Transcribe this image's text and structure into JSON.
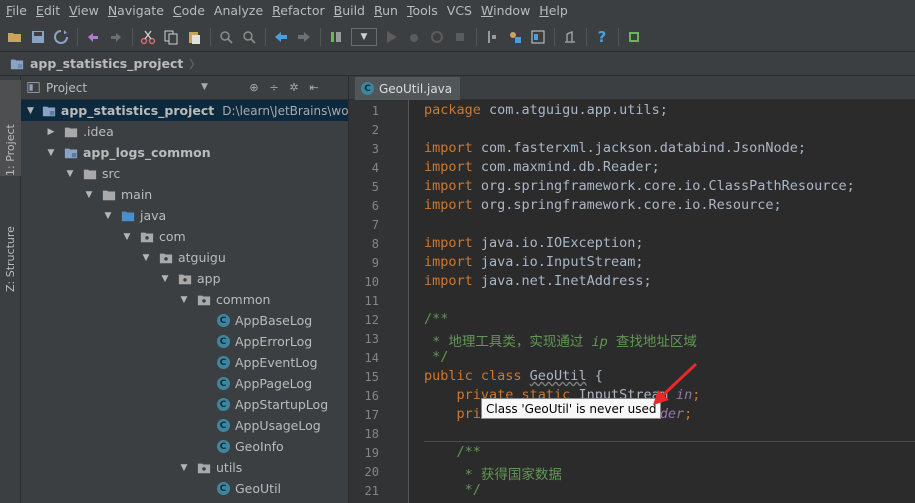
{
  "menu": [
    {
      "first": "F",
      "rest": "ile"
    },
    {
      "first": "E",
      "rest": "dit"
    },
    {
      "first": "V",
      "rest": "iew"
    },
    {
      "first": "N",
      "rest": "avigate"
    },
    {
      "first": "C",
      "rest": "ode"
    },
    {
      "first": "",
      "rest": "Analyze"
    },
    {
      "first": "R",
      "rest": "efactor"
    },
    {
      "first": "B",
      "rest": "uild"
    },
    {
      "first": "R",
      "rest": "un"
    },
    {
      "first": "T",
      "rest": "ools"
    },
    {
      "first": "",
      "rest": "VCS"
    },
    {
      "first": "W",
      "rest": "indow"
    },
    {
      "first": "H",
      "rest": "elp"
    }
  ],
  "breadcrumb": {
    "project": "app_statistics_project"
  },
  "toolstrip": {
    "project_tab": "1: Project",
    "structure_tab": "Z: Structure"
  },
  "project_panel": {
    "title": "Project",
    "tree": [
      {
        "label": "app_statistics_project",
        "path": "D:\\learn\\JetBrains\\worksp",
        "depth": 0,
        "expanded": true,
        "bold": true,
        "icon": "module-folder-icon",
        "selected": true
      },
      {
        "label": ".idea",
        "depth": 1,
        "expanded": false,
        "icon": "folder-icon"
      },
      {
        "label": "app_logs_common",
        "depth": 1,
        "expanded": true,
        "bold": true,
        "icon": "module-folder-icon"
      },
      {
        "label": "src",
        "depth": 2,
        "expanded": true,
        "icon": "folder-icon"
      },
      {
        "label": "main",
        "depth": 3,
        "expanded": true,
        "icon": "folder-icon"
      },
      {
        "label": "java",
        "depth": 4,
        "expanded": true,
        "icon": "source-folder-icon"
      },
      {
        "label": "com",
        "depth": 5,
        "expanded": true,
        "icon": "package-icon"
      },
      {
        "label": "atguigu",
        "depth": 6,
        "expanded": true,
        "icon": "package-icon"
      },
      {
        "label": "app",
        "depth": 7,
        "expanded": true,
        "icon": "package-icon"
      },
      {
        "label": "common",
        "depth": 8,
        "expanded": true,
        "icon": "package-icon"
      },
      {
        "label": "AppBaseLog",
        "depth": 9,
        "icon": "class-icon"
      },
      {
        "label": "AppErrorLog",
        "depth": 9,
        "icon": "class-icon"
      },
      {
        "label": "AppEventLog",
        "depth": 9,
        "icon": "class-icon"
      },
      {
        "label": "AppPageLog",
        "depth": 9,
        "icon": "class-icon"
      },
      {
        "label": "AppStartupLog",
        "depth": 9,
        "icon": "class-icon"
      },
      {
        "label": "AppUsageLog",
        "depth": 9,
        "icon": "class-icon"
      },
      {
        "label": "GeoInfo",
        "depth": 9,
        "icon": "class-icon"
      },
      {
        "label": "utils",
        "depth": 8,
        "expanded": true,
        "icon": "package-icon"
      },
      {
        "label": "GeoUtil",
        "depth": 9,
        "icon": "class-icon"
      }
    ]
  },
  "editor": {
    "tab_label": "GeoUtil.java",
    "line_numbers": [
      "1",
      "2",
      "3",
      "4",
      "5",
      "6",
      "7",
      "8",
      "9",
      "10",
      "11",
      "12",
      "13",
      "14",
      "15",
      "16",
      "17",
      "18",
      "19",
      "20",
      "21"
    ],
    "code": {
      "l1_kw": "package",
      "l1_rest": " com.atguigu.app.utils;",
      "l3_kw": "import",
      "l3_rest": " com.fasterxml.jackson.databind.JsonNode;",
      "l4_kw": "import",
      "l4_rest": " com.maxmind.db.Reader;",
      "l5_kw": "import",
      "l5_rest": " org.springframework.core.io.ClassPathResource;",
      "l6_kw": "import",
      "l6_rest": " org.springframework.core.io.Resource;",
      "l8_kw": "import",
      "l8_rest": " java.io.IOException;",
      "l9_kw": "import",
      "l9_rest": " java.io.InputStream;",
      "l10_kw": "import",
      "l10_rest": " java.net.InetAddress;",
      "l12": "/**",
      "l13_a": " * 地理工具类，实现通过 ",
      "l13_b": "ip",
      "l13_c": " 查找地址区域",
      "l14": " */",
      "l15_kw": "public class ",
      "l15_name": "GeoUtil",
      "l15_rest": " {",
      "l16_kw": "    private static ",
      "l16_type": "InputStream ",
      "l16_field": "in",
      "l17_kw": "    private static ",
      "l17_type": "Reader ",
      "l17_field": "reader",
      "l19": "    /**",
      "l20": "     * 获得国家数据",
      "l21": "     */"
    },
    "tooltip": "Class 'GeoUtil' is never used"
  },
  "colors": {
    "keyword": "#cc7832",
    "comment": "#629755",
    "field": "#9876aa",
    "annotation_arrow": "#e8292a"
  }
}
